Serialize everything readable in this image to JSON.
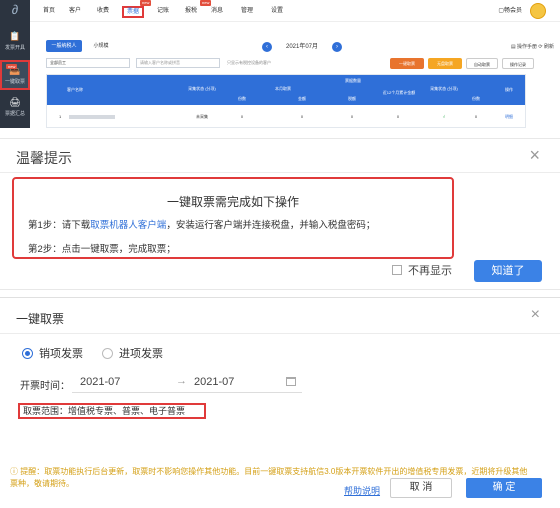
{
  "app": {
    "sidebar": [
      {
        "label": "发票开具",
        "icon": "📋"
      },
      {
        "label": "一键取票",
        "icon": "📥",
        "badge": "new"
      },
      {
        "label": "票据汇总",
        "icon": "🖨"
      }
    ],
    "nav": [
      "首页",
      "客户",
      "收费",
      "票据",
      "记账",
      "报税",
      "消息",
      "管理",
      "设置"
    ],
    "nav_badge": "new",
    "vip": "▢畅会员",
    "tabs": [
      "一般纳税人",
      "小规模"
    ],
    "month": "2021年07月",
    "help_links": "▤ 操作手册  ⟳ 刷新",
    "filter_staff": "全部员工",
    "filter_search_placeholder": "请输入客户名称或拼音",
    "checkbox_label": "只显示有税控设备的客户",
    "buttons": [
      "一键取票",
      "无盘取票",
      "自动取票",
      "操作记录"
    ],
    "table": {
      "group_header": "票据数量",
      "cols": [
        "客户名称",
        "采集状态 (分项)",
        "本月取票",
        "份数",
        "金额",
        "税额",
        "近12个月累计金额",
        "采集状态 (分项)",
        "份数",
        "操作"
      ],
      "row": {
        "index": "1",
        "status": "未采集",
        "count": "0",
        "amount": "0",
        "tax": "0",
        "total": "0",
        "check": "√",
        "count2": "0",
        "action": "明细"
      }
    }
  },
  "tip": {
    "title": "温馨提示",
    "close": "×",
    "box_title": "一键取票需完成如下操作",
    "step1_a": "第1步：请下载",
    "step1_link": "取票机器人客户端",
    "step1_b": "，安装运行客户端并连接税盘，并输入税盘密码；",
    "step2": "第2步：点击一键取票，完成取票；",
    "no_more": "不再显示",
    "ok": "知道了"
  },
  "dialog": {
    "title": "一键取票",
    "close": "×",
    "radio_sales": "销项发票",
    "radio_purchase": "进项发票",
    "date_label": "开票时间：",
    "date_from": "2021-07",
    "date_arrow": "→",
    "date_to": "2021-07",
    "scope": "取票范围：增值税专票、普票、电子普票",
    "notice": "ⓘ 提醒：取票功能执行后台更新，取票时不影响您操作其他功能。目前一键取票支持航信3.0版本开票软件开出的增值税专用发票，近期将升级其他票种，敬请期待。",
    "help": "帮助说明",
    "cancel": "取 消",
    "confirm": "确 定"
  },
  "colors": {
    "accent": "#2f6fd8",
    "highlight": "#e03a3a",
    "orange": "#e8742e",
    "warning": "#d4a017"
  }
}
